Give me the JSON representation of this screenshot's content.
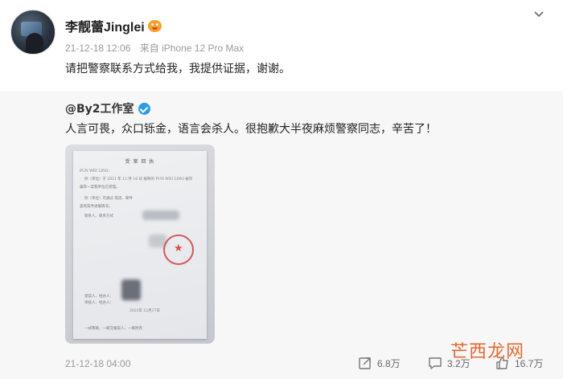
{
  "post": {
    "username": "李靓蕾Jinglei",
    "timestamp": "21-12-18 12:06",
    "source": "来自 iPhone 12 Pro Max",
    "text": "请把警察联系方式给我，我提供证据，谢谢。"
  },
  "repost": {
    "author": "@By2工作室",
    "text": "人言可畏，众口铄金，语言会杀人。很抱歉大半夜麻烦警察同志，辛苦了！",
    "document": {
      "title": "受 案 回 执",
      "lines": [
        "PUN WEI LING：",
        "你（单位）于 2021 年 12 月 16 日 报称的 PUN WEI LING 被诈",
        "骗等一案我单位已受理。",
        "你（单位）可通过  电话、邮件",
        "查询案件进展情况。",
        "联系人、联系方式"
      ],
      "footer_date": "2021年 12月17日",
      "footer_lines": [
        "受案人、经办人：",
        "审核人、经办人：",
        "一式两联，一联交报案人，一联附卷"
      ]
    },
    "time": "21-12-18 04:00",
    "actions": {
      "share_count": "6.8万",
      "comment_count": "3.2万",
      "like_count": "16.7万"
    }
  },
  "watermark": {
    "text": "芒西龙网"
  },
  "colors": {
    "verified": "#2d9be8",
    "vip": "#f7a22a",
    "repost_bg": "#f7f7f7",
    "watermark": "#e05a1e"
  },
  "icons": {
    "options": "chevron-down-icon",
    "share": "share-icon",
    "comment": "comment-icon",
    "like": "like-icon"
  }
}
